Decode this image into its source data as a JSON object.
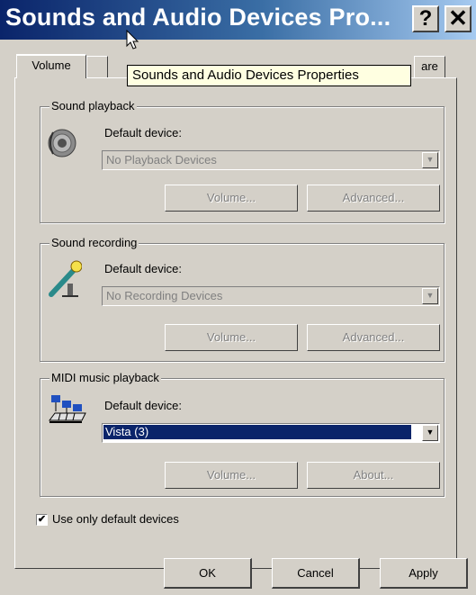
{
  "window": {
    "title": "Sounds and Audio Devices Pro...",
    "help_label": "?",
    "close_label": "✕"
  },
  "tabs": [
    {
      "label": "Volume",
      "selected": true
    },
    {
      "label": "",
      "selected": false
    },
    {
      "label": "are",
      "selected": false
    }
  ],
  "tooltip": "Sounds and Audio Devices Properties",
  "sound_playback": {
    "group_label": "Sound playback",
    "device_label": "Default device:",
    "selected_device": "No Playback Devices",
    "volume_button": "Volume...",
    "advanced_button": "Advanced...",
    "icon": "speaker-icon"
  },
  "sound_recording": {
    "group_label": "Sound recording",
    "device_label": "Default device:",
    "selected_device": "No Recording Devices",
    "volume_button": "Volume...",
    "advanced_button": "Advanced...",
    "icon": "microphone-icon"
  },
  "midi_playback": {
    "group_label": "MIDI music playback",
    "device_label": "Default device:",
    "selected_device": "Vista (3)",
    "volume_button": "Volume...",
    "about_button": "About...",
    "icon": "keyboard-icon"
  },
  "use_default_devices": {
    "label": "Use only default devices",
    "checked": true
  },
  "buttons": {
    "ok": "OK",
    "cancel": "Cancel",
    "apply": "Apply"
  },
  "colors": {
    "title_gradient_start": "#0a246a",
    "title_gradient_end": "#a6caf0",
    "face": "#d4d0c8",
    "highlight": "#0a246a",
    "tooltip_bg": "#ffffe1"
  }
}
